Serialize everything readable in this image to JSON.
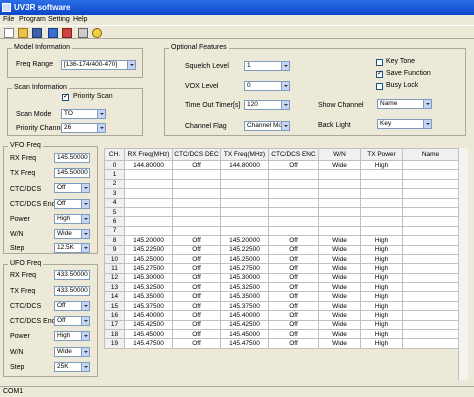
{
  "window": {
    "title": "UV3R software"
  },
  "menu": [
    "File",
    "Program",
    "Setting",
    "Help"
  ],
  "toolbar_icons": [
    "new-file-icon",
    "open-folder-icon",
    "save-icon",
    "read-radio-icon",
    "write-radio-icon",
    "print-icon",
    "about-icon"
  ],
  "model_info": {
    "legend": "Model Information",
    "freq_range_label": "Freq Range",
    "freq_range_value": "[136-174/400-470]"
  },
  "scan_info": {
    "legend": "Scan Information",
    "priority_scan_label": "Priority Scan",
    "priority_scan_checked": true,
    "scan_mode_label": "Scan Mode",
    "scan_mode_value": "TO",
    "priority_channel_label": "Priority Channel",
    "priority_channel_value": "26"
  },
  "optional": {
    "legend": "Optional Features",
    "squelch_label": "Squelch Level",
    "squelch_value": "1",
    "vox_label": "VOX Level",
    "vox_value": "0",
    "tot_label": "Time Out Timer[s]",
    "tot_value": "120",
    "channel_flag_label": "Channel Flag",
    "channel_flag_value": "Channel Mode",
    "show_channel_label": "Show Channel",
    "show_channel_value": "Name",
    "back_light_label": "Back Light",
    "back_light_value": "Key",
    "key_tone_label": "Key Tone",
    "key_tone_checked": false,
    "save_function_label": "Save Function",
    "save_function_checked": true,
    "busy_lock_label": "Busy Lock",
    "busy_lock_checked": false
  },
  "vfo": {
    "legend": "VFO Freq",
    "rx_label": "RX Freq",
    "rx_value": "145.50000",
    "tx_label": "TX Freq",
    "tx_value": "145.50000",
    "ctc_label": "CTC/DCS",
    "ctc_value": "Off",
    "ctc_enc_label": "CTC/DCS Enc",
    "ctc_enc_value": "Off",
    "power_label": "Power",
    "power_value": "High",
    "wn_label": "W/N",
    "wn_value": "Wide",
    "step_label": "Step",
    "step_value": "12.5K"
  },
  "ufo": {
    "legend": "UFO Freq",
    "rx_label": "RX Freq",
    "rx_value": "433.50000",
    "tx_label": "TX Freq",
    "tx_value": "433.50000",
    "ctc_label": "CTC/DCS",
    "ctc_value": "Off",
    "ctc_enc_label": "CTC/DCS Enc",
    "ctc_enc_value": "Off",
    "power_label": "Power",
    "power_value": "High",
    "wn_label": "W/N",
    "wn_value": "Wide",
    "step_label": "Step",
    "step_value": "25K"
  },
  "table": {
    "headers": [
      "CH.",
      "RX Freq(MHz)",
      "CTC/DCS DEC",
      "TX Freq(MHz)",
      "CTC/DCS ENC",
      "W/N",
      "TX Power",
      "Name"
    ],
    "rows": [
      [
        "0",
        "144.80000",
        "Off",
        "144.80000",
        "Off",
        "Wide",
        "High",
        ""
      ],
      [
        "1",
        "",
        "",
        "",
        "",
        "",
        "",
        ""
      ],
      [
        "2",
        "",
        "",
        "",
        "",
        "",
        "",
        ""
      ],
      [
        "3",
        "",
        "",
        "",
        "",
        "",
        "",
        ""
      ],
      [
        "4",
        "",
        "",
        "",
        "",
        "",
        "",
        ""
      ],
      [
        "5",
        "",
        "",
        "",
        "",
        "",
        "",
        ""
      ],
      [
        "6",
        "",
        "",
        "",
        "",
        "",
        "",
        ""
      ],
      [
        "7",
        "",
        "",
        "",
        "",
        "",
        "",
        ""
      ],
      [
        "8",
        "145.20000",
        "Off",
        "145.20000",
        "Off",
        "Wide",
        "High",
        ""
      ],
      [
        "9",
        "145.22500",
        "Off",
        "145.22500",
        "Off",
        "Wide",
        "High",
        ""
      ],
      [
        "10",
        "145.25000",
        "Off",
        "145.25000",
        "Off",
        "Wide",
        "High",
        ""
      ],
      [
        "11",
        "145.27500",
        "Off",
        "145.27500",
        "Off",
        "Wide",
        "High",
        ""
      ],
      [
        "12",
        "145.30000",
        "Off",
        "145.30000",
        "Off",
        "Wide",
        "High",
        ""
      ],
      [
        "13",
        "145.32500",
        "Off",
        "145.32500",
        "Off",
        "Wide",
        "High",
        ""
      ],
      [
        "14",
        "145.35000",
        "Off",
        "145.35000",
        "Off",
        "Wide",
        "High",
        ""
      ],
      [
        "15",
        "145.37500",
        "Off",
        "145.37500",
        "Off",
        "Wide",
        "High",
        ""
      ],
      [
        "16",
        "145.40000",
        "Off",
        "145.40000",
        "Off",
        "Wide",
        "High",
        ""
      ],
      [
        "17",
        "145.42500",
        "Off",
        "145.42500",
        "Off",
        "Wide",
        "High",
        ""
      ],
      [
        "18",
        "145.45000",
        "Off",
        "145.45000",
        "Off",
        "Wide",
        "High",
        ""
      ],
      [
        "19",
        "145.47500",
        "Off",
        "145.47500",
        "Off",
        "Wide",
        "High",
        ""
      ]
    ]
  },
  "status": {
    "port": "COM1"
  }
}
